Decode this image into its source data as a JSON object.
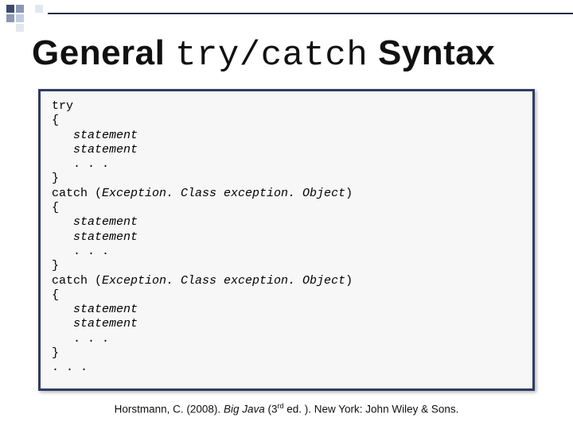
{
  "title": {
    "part1": "General ",
    "code": "try/catch",
    "part2": " Syntax"
  },
  "code": {
    "l01": "try",
    "l02": "{",
    "l03": "   statement",
    "l04": "   statement",
    "l05": "   . . .",
    "l06": "}",
    "l07a": "catch (",
    "l07b": "Exception. Class exception. Object",
    "l07c": ")",
    "l08": "{",
    "l09": "   statement",
    "l10": "   statement",
    "l11": "   . . .",
    "l12": "}",
    "l13a": "catch (",
    "l13b": "Exception. Class exception. Object",
    "l13c": ")",
    "l14": "{",
    "l15": "   statement",
    "l16": "   statement",
    "l17": "   . . .",
    "l18": "}",
    "l19": ". . ."
  },
  "citation": {
    "prefix": "Horstmann, C. (2008). ",
    "book": "Big Java",
    "edition_open": " (3",
    "edition_sup": "rd",
    "rest": " ed. ). New York: John Wiley & Sons."
  }
}
